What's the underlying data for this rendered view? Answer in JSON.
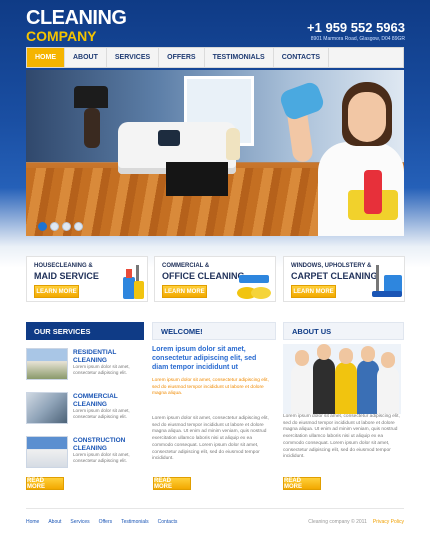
{
  "header": {
    "logo_line1": "CLEANING",
    "logo_line2": "COMPANY",
    "phone": "+1 959 552 5963",
    "address": "8901 Marmora Road, Glasgow, D04 89GR"
  },
  "nav": {
    "items": [
      {
        "label": "Home",
        "active": true
      },
      {
        "label": "About",
        "active": false
      },
      {
        "label": "Services",
        "active": false
      },
      {
        "label": "Offers",
        "active": false
      },
      {
        "label": "Testimonials",
        "active": false
      },
      {
        "label": "Contacts",
        "active": false
      }
    ]
  },
  "slider": {
    "dots": 4,
    "active_dot": 0
  },
  "promos": [
    {
      "line1": "Housecleaning &",
      "line2": "Maid Service",
      "button": "Learn More"
    },
    {
      "line1": "Commercial &",
      "line2": "Office Cleaning",
      "button": "Learn More"
    },
    {
      "line1": "Windows, Upholstery &",
      "line2": "Carpet Cleaning",
      "button": "Learn More"
    }
  ],
  "services": {
    "heading": "Our Services",
    "items": [
      {
        "title": "Residential Cleaning",
        "desc": "Lorem ipsum dolor sit amet, consectetur adipiscing elit."
      },
      {
        "title": "Commercial Cleaning",
        "desc": "Lorem ipsum dolor sit amet, consectetur adipiscing elit."
      },
      {
        "title": "Construction Cleaning",
        "desc": "Lorem ipsum dolor sit amet, consectetur adipiscing elit."
      }
    ],
    "button": "Read More"
  },
  "welcome": {
    "heading": "Welcome!",
    "title": "Lorem ipsum dolor sit amet, consectetur adipiscing elit, sed diam tempor incididunt ut",
    "orange": "Lorem ipsum dolor sit amet, consectetur adipiscing elit, sed do eiusmod tempor incididunt ut labore et dolore magna aliqua.",
    "body": "Lorem ipsum dolor sit amet, consectetur adipiscing elit, sed do eiusmod tempor incididunt ut labore et dolore magna aliqua. Ut enim ad minim veniam, quis nostrud exercitation ullamco laboris nisi ut aliquip ex ea commodo consequat. Lorem ipsum dolor sit amet, consectetur adipiscing elit, sed do eiusmod tempor incididunt.",
    "button": "Read More"
  },
  "about": {
    "heading": "About Us",
    "body": "Lorem ipsum dolor sit amet, consectetur adipiscing elit, sed do eiusmod tempor incididunt ut labore et dolore magna aliqua. Ut enim ad minim veniam, quis nostrud exercitation ullamco laboris nisi ut aliquip ex ea commodo consequat. Lorem ipsum dolor sit amet, consectetur adipiscing elit, sed do eiusmod tempor incididunt.",
    "button": "Read More"
  },
  "footer": {
    "links": [
      "Home",
      "About",
      "Services",
      "Offers",
      "Testimonials",
      "Contacts"
    ],
    "copyright": "Cleaning company © 2011",
    "privacy": "Privacy Policy"
  },
  "colors": {
    "brand_blue": "#0f3b86",
    "accent_yellow": "#f5b400",
    "link_blue": "#1a55b5",
    "text_orange": "#f08a00"
  }
}
